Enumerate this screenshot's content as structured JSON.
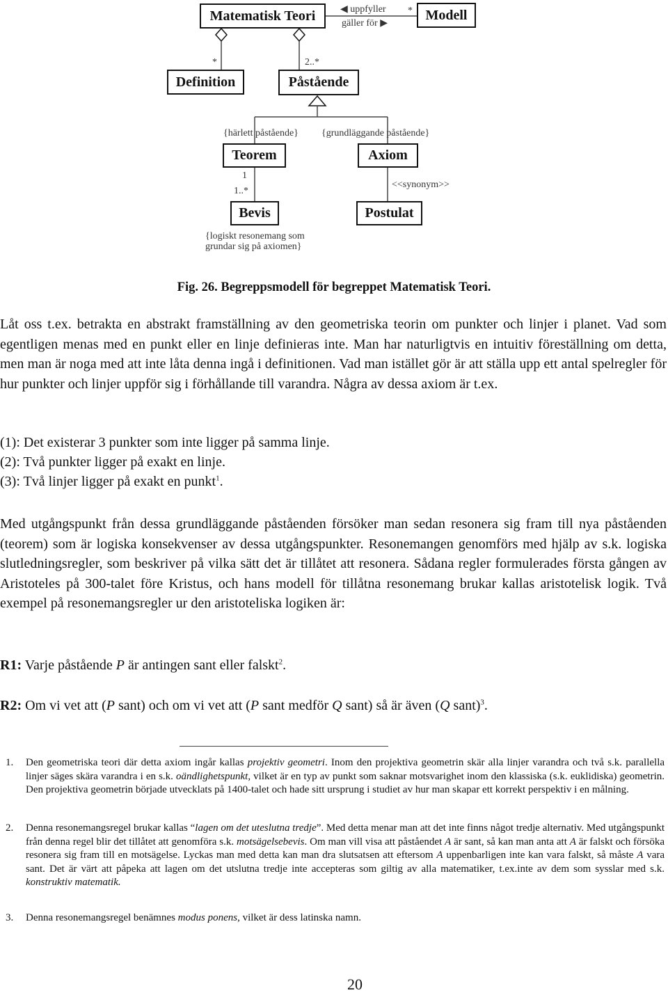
{
  "diagram": {
    "boxes": {
      "matematisk_teori": "Matematisk Teori",
      "modell": "Modell",
      "definition": "Definition",
      "pastaende": "Påstående",
      "teorem": "Teorem",
      "axiom": "Axiom",
      "bevis": "Bevis",
      "postulat": "Postulat"
    },
    "labels": {
      "uppfyller": "◀ uppfyller",
      "galler_for": "gäller för ▶",
      "modell_mult": "*",
      "definition_mult": "*",
      "pastaende_mult": "2..*",
      "harlett": "{härlett påstående}",
      "grundlaggande": "{grundläggande påstående}",
      "teorem_mult": "1",
      "bevis_mult": "1..*",
      "synonym": "<<synonym>>",
      "bevis_note_line1": "{logiskt resonemang som",
      "bevis_note_line2": "grundar sig på axiomen}"
    }
  },
  "caption": "Fig. 26. Begreppsmodell för begreppet Matematisk Teori.",
  "intro_paragraph": "Låt oss t.ex. betrakta en abstrakt framställning av den geometriska teorin om punkter och linjer i planet. Vad som egentligen menas med en punkt eller en linje definieras inte. Man har naturligtvis en intuitiv föreställning om detta, men man är noga med att inte låta denna ingå i definitionen. Vad man istället gör är att ställa upp ett antal spelregler för hur punkter och linjer uppför sig i förhållande till varandra. Några av dessa axiom är t.ex.",
  "axioms": [
    {
      "text": "(1): Det existerar 3 punkter som inte ligger på samma linje.",
      "footnote": ""
    },
    {
      "text": "(2): Två punkter ligger på exakt en linje.",
      "footnote": ""
    },
    {
      "text": "(3): Två linjer ligger på exakt en punkt",
      "footnote": "1",
      "end": "."
    }
  ],
  "reasoning_paragraph": "Med utgångspunkt från dessa grundläggande påståenden försöker man sedan resonera sig fram till nya påståenden (teorem) som är logiska konsekvenser av dessa utgångspunkter. Resonemangen genomförs med hjälp av s.k. logiska slutledningsregler, som beskriver på vilka sätt det är tillåtet att resonera. Sådana regler formulerades första gången av Aristoteles på 300-talet före Kristus, och hans modell för tillåtna resonemang brukar kallas aristotelisk logik. Två exempel på resonemangsregler ur den aristoteliska logiken är:",
  "rules": {
    "r1": {
      "label": "R1:",
      "pre": " Varje påstående ",
      "var": "P",
      "post": " är antingen sant eller falskt",
      "footnote": "2",
      "end": "."
    },
    "r2": {
      "label": "R2:",
      "t1": " Om vi vet att (",
      "v1": "P",
      "t2": " sant) och om vi vet att (",
      "v2": "P",
      "t3": " sant medför ",
      "v3": "Q",
      "t4": " sant) så är även (",
      "v4": "Q",
      "t5": " sant)",
      "footnote": "3",
      "end": "."
    }
  },
  "footnotes": [
    {
      "num": "1.",
      "parts": [
        {
          "t": "Den geometriska teori där detta axiom ingår kallas ",
          "i": false
        },
        {
          "t": "projektiv geometri",
          "i": true
        },
        {
          "t": ". Inom den projektiva geometrin skär alla linjer varandra och två s.k. parallella linjer säges skära varandra i en s.k. ",
          "i": false
        },
        {
          "t": "oändlighetspunkt",
          "i": true
        },
        {
          "t": ", vilket är en typ av punkt som saknar motsvarighet inom den klassiska (s.k. euklidiska) geometrin. Den projektiva geometrin började utvecklats på 1400-talet och hade sitt ursprung i studiet av hur man skapar ett korrekt perspektiv i en målning.",
          "i": false
        }
      ]
    },
    {
      "num": "2.",
      "parts": [
        {
          "t": "Denna resonemangsregel brukar kallas “",
          "i": false
        },
        {
          "t": "lagen om det uteslutna tredje",
          "i": true
        },
        {
          "t": "”. Med detta menar man att det inte finns något tredje alternativ. Med utgångspunkt från denna regel blir det tillåtet att genomföra s.k. ",
          "i": false
        },
        {
          "t": "motsägelsebevis",
          "i": true
        },
        {
          "t": ". Om man vill visa att påståendet ",
          "i": false
        },
        {
          "t": "A",
          "i": true
        },
        {
          "t": " är sant, så kan man anta att ",
          "i": false
        },
        {
          "t": "A",
          "i": true
        },
        {
          "t": " är falskt och försöka resonera sig fram till en motsägelse. Lyckas man med detta kan man dra slutsatsen att eftersom ",
          "i": false
        },
        {
          "t": "A",
          "i": true
        },
        {
          "t": " uppenbarligen inte kan vara falskt, så måste ",
          "i": false
        },
        {
          "t": "A",
          "i": true
        },
        {
          "t": " vara sant. Det är värt att påpeka att lagen om det utslutna tredje inte accepteras som giltig av alla matematiker, t.ex.inte av dem som sysslar med s.k. ",
          "i": false
        },
        {
          "t": "konstruktiv matematik.",
          "i": true
        }
      ]
    },
    {
      "num": "3.",
      "parts": [
        {
          "t": "Denna resonemangsregel benämnes ",
          "i": false
        },
        {
          "t": "modus ponens",
          "i": true
        },
        {
          "t": ", vilket är dess latinska namn.",
          "i": false
        }
      ]
    }
  ],
  "page_number": "20"
}
